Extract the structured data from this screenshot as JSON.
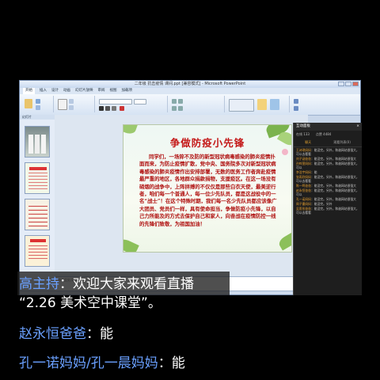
{
  "window": {
    "title": "二年级 抗击疫情 课间.ppt [兼容模式] - Microsoft PowerPoint",
    "tabs": [
      "开始",
      "插入",
      "设计",
      "动画",
      "幻灯片放映",
      "审阅",
      "视图",
      "加载项"
    ]
  },
  "left_pane": {
    "header": "幻灯片",
    "thumbs": [
      {
        "num": "1"
      },
      {
        "num": "2"
      },
      {
        "num": "3"
      },
      {
        "num": "4"
      }
    ]
  },
  "slide": {
    "title": "争做防疫小先锋",
    "body": "同学们，一场猝不及防的新型冠状病毒感染的肺炎疫情扑面而来，为防止疫情扩散，党中央、国务院多次对新型冠状病毒感染的肺炎疫情作出安排部署，无数的医务工作者奔赴疫情最严重的地区，各地群众捐款捐物，支援疫区。在这一场没有硝烟的战争中，上阵拼搏的不仅仅是那些白衣天使，最美逆行者，咱们每一个普通人，每一位少先队员，都是这战役中的一名“战士”！在这个特殊时期，我们每一名少先队员都应该像广大团员、党员们一样，具有使命担当，争做防疫小先锋，以自己力所能及的方式去保护自己和家人，向奋战在疫情防控一线的先锋们致敬，为祖国加油！"
  },
  "notes": {
    "placeholder": "单击此处添加备注"
  },
  "chat_panel": {
    "title": "互动面板",
    "close": "×",
    "stats": [
      "在线 133",
      "点赞 4484"
    ],
    "tabs": [
      "聊天",
      "观看列表(0)"
    ],
    "messages": [
      {
        "who": "王诗琪妈妈",
        "text": "：能没完。另外，和谐网站很强大，可以去看看"
      },
      {
        "who": "刘子涵爸爸",
        "text": "：能没完。另外，和谐网站很强大"
      },
      {
        "who": "孙梓萱妈妈",
        "text": "：能没完。另外，和谐网站很强大，可以"
      },
      {
        "who": "李浩宇妈妈",
        "text": "：能"
      },
      {
        "who": "张雨欣妈妈",
        "text": "：能没完。另外，和谐网站很强大，可以去看看"
      },
      {
        "who": "陈一鸣爸爸",
        "text": "：能没完。另外，和谐网站很强大"
      },
      {
        "who": "赵永恒爸爸",
        "text": "：能没完。另外，和谐网站很强大，可以"
      },
      {
        "who": "孔一诺妈妈",
        "text": "：能没完。另外，和谐网站很强大"
      },
      {
        "who": "周子墨妈妈",
        "text": "：能没完。另外"
      },
      {
        "who": "吴思彤爸爸",
        "text": "：能没完。另外，和谐网站很强大，可以去看看"
      }
    ]
  },
  "overlay": {
    "lines": [
      {
        "name": "高主持",
        "sep": "：",
        "text": "欢迎大家来观看直播"
      },
      {
        "name": "",
        "sep": "",
        "text": "“2.26 美术空中课堂”。"
      },
      {
        "name": "赵永恒爸爸",
        "sep": "：",
        "text": "能"
      },
      {
        "name": "孔一诺妈妈/孔一晨妈妈",
        "sep": "：",
        "text": "能"
      }
    ]
  },
  "colors": {
    "slide_text": "#b01010",
    "slide_title": "#c41818",
    "name_blue": "#6aa0ff"
  }
}
